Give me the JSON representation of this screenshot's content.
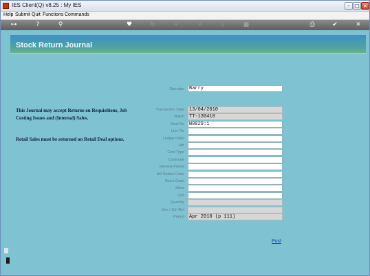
{
  "window": {
    "title": "IES Client(Q) v8.25 : My IES"
  },
  "menu": [
    "Help",
    "Submit",
    "Quit",
    "Functions",
    "Commands"
  ],
  "header": {
    "title": "Stock Return Journal"
  },
  "info": {
    "paragraph1": "This Journal may accept Returns on Requisitions, Job Costing Issues and (Internal) Sales.",
    "paragraph2": "Retail Sales must be returned on Retail Deal options."
  },
  "form": {
    "operator": {
      "label": "Operator",
      "value": "Barry"
    },
    "fields": [
      {
        "label": "Transaction Date",
        "value": "  13/04/2010",
        "readonly": true
      },
      {
        "label": "Batch",
        "value": "TT-130410",
        "readonly": true
      },
      {
        "label": "Deal No",
        "value": "W0029:1",
        "readonly": false
      },
      {
        "label": "Line No",
        "value": "",
        "readonly": false
      },
      {
        "label": "Ledger Debit",
        "value": "",
        "readonly": false
      },
      {
        "label": "Job",
        "value": "",
        "readonly": false
      },
      {
        "label": "Cost Type",
        "value": "",
        "readonly": false
      },
      {
        "label": "Costcode",
        "value": "",
        "readonly": false
      },
      {
        "label": "Harvest Period",
        "value": "",
        "readonly": false
      },
      {
        "label": "AR Debtor Code",
        "value": "",
        "readonly": false
      },
      {
        "label": "Stock Code",
        "value": "",
        "readonly": false
      },
      {
        "label": "Store",
        "value": "",
        "readonly": false
      },
      {
        "label": "Unit",
        "value": "",
        "readonly": false
      },
      {
        "label": "Quantity",
        "value": "",
        "readonly": true
      },
      {
        "label": "Doc / Ctrl Ref",
        "value": "",
        "readonly": true
      },
      {
        "label": "Period",
        "value": "Apr 2010 (p 111)",
        "readonly": true
      }
    ]
  },
  "actions": {
    "post": "Post"
  },
  "toolbar_icons": [
    "key-icon",
    "help-icon",
    "search-icon",
    "heart-icon",
    "refresh-icon",
    "rewind-icon",
    "forward-icon",
    "trash-icon",
    "save-icon",
    "print-icon",
    "check-icon",
    "close-icon"
  ],
  "colors": {
    "background": "#7fc3d3",
    "header": "#3f8fc9",
    "link": "#0a39c2"
  }
}
